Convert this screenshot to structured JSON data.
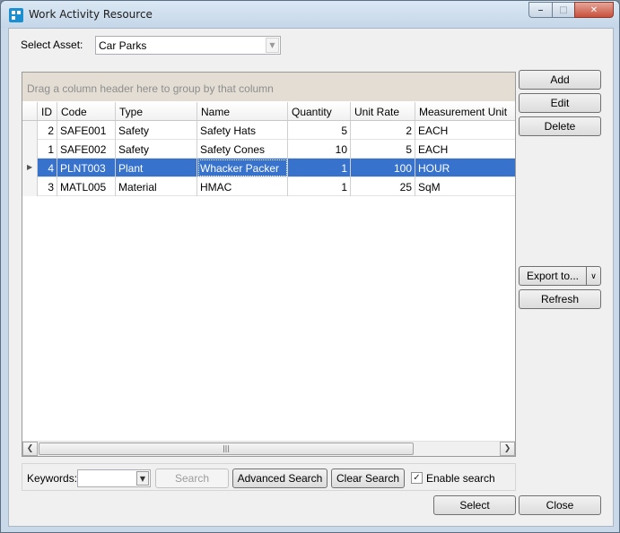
{
  "window": {
    "title": "Work Activity Resource"
  },
  "asset": {
    "label": "Select Asset:",
    "value": "Car Parks"
  },
  "grid": {
    "group_hint": "Drag a column header here to group by that column",
    "columns": [
      "ID",
      "Code",
      "Type",
      "Name",
      "Quantity",
      "Unit Rate",
      "Measurement Unit"
    ],
    "rows": [
      {
        "id": "2",
        "code": "SAFE001",
        "type": "Safety",
        "name": "Safety Hats",
        "quantity": "5",
        "unit_rate": "2",
        "unit": "EACH"
      },
      {
        "id": "1",
        "code": "SAFE002",
        "type": "Safety",
        "name": "Safety Cones",
        "quantity": "10",
        "unit_rate": "5",
        "unit": "EACH"
      },
      {
        "id": "4",
        "code": "PLNT003",
        "type": "Plant",
        "name": "Whacker Packer",
        "quantity": "1",
        "unit_rate": "100",
        "unit": "HOUR"
      },
      {
        "id": "3",
        "code": "MATL005",
        "type": "Material",
        "name": "HMAC",
        "quantity": "1",
        "unit_rate": "25",
        "unit": "SqM"
      }
    ],
    "selected_row": 2
  },
  "side_buttons": {
    "add": "Add",
    "edit": "Edit",
    "delete": "Delete",
    "export": "Export to...",
    "refresh": "Refresh"
  },
  "search": {
    "keywords_label": "Keywords:",
    "keywords_value": "",
    "search": "Search",
    "advanced": "Advanced Search",
    "clear": "Clear Search",
    "enable_label": "Enable search",
    "enable_checked": true
  },
  "footer": {
    "select": "Select",
    "close": "Close"
  },
  "colors": {
    "selection": "#3772cc",
    "group_panel": "#e3ddd3"
  }
}
